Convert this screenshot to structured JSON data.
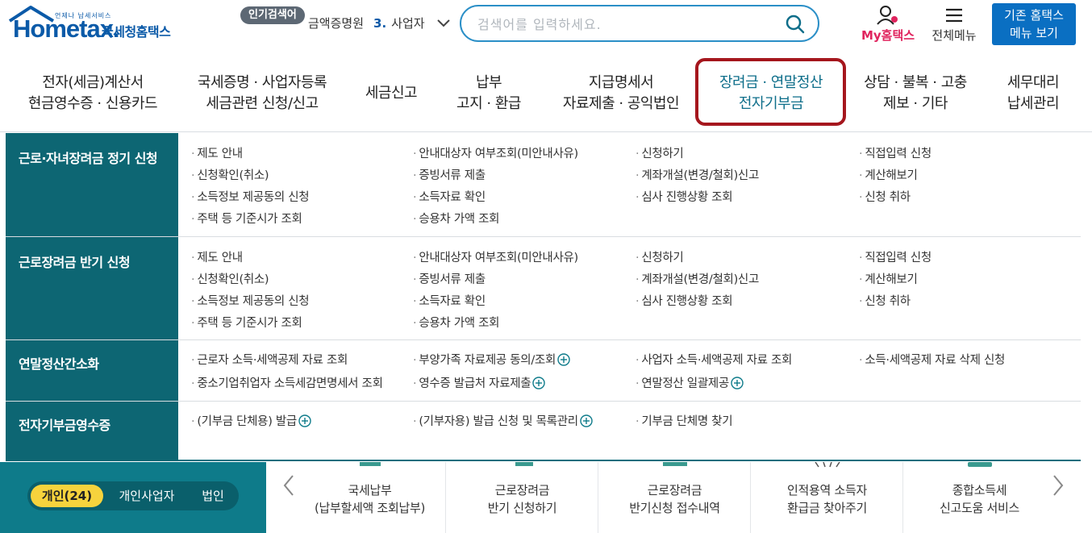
{
  "header": {
    "logo_small": "언제나 납세서비스",
    "logo_brand": "Hometax.",
    "logo_kr": "국세청홈택스",
    "popular_badge": "인기검색어",
    "ticker_text": "금액증명원",
    "ticker_num": "3.",
    "ticker_next": "사업자",
    "search_placeholder": "검색어를 입력하세요.",
    "my_hometax": "My홈택스",
    "all_menu": "전체메뉴",
    "old_menu_line1": "기존 홈택스",
    "old_menu_line2": "메뉴 보기"
  },
  "gnb": [
    {
      "line1": "전자(세금)계산서",
      "line2": "현금영수증 · 신용카드"
    },
    {
      "line1": "국세증명 · 사업자등록",
      "line2": "세금관련 신청/신고"
    },
    {
      "line1": "세금신고",
      "line2": ""
    },
    {
      "line1": "납부",
      "line2": "고지 · 환급"
    },
    {
      "line1": "지급명세서",
      "line2": "자료제출 · 공익법인"
    },
    {
      "line1": "장려금 · 연말정산",
      "line2": "전자기부금"
    },
    {
      "line1": "상담 · 불복 · 고충",
      "line2": "제보 · 기타"
    },
    {
      "line1": "세무대리",
      "line2": "납세관리"
    }
  ],
  "mega": {
    "rows": [
      {
        "title": "근로·자녀장려금 정기 신청",
        "links": [
          "제도 안내",
          "안내대상자 여부조회(미안내사유)",
          "신청하기",
          "직접입력 신청",
          "신청확인(취소)",
          "증빙서류 제출",
          "계좌개설(변경/철회)신고",
          "계산해보기",
          "소득정보 제공동의 신청",
          "소득자료 확인",
          "심사 진행상황 조회",
          "신청 취하",
          "주택 등 기준시가 조회",
          "승용차 가액 조회"
        ]
      },
      {
        "title": "근로장려금 반기 신청",
        "links": [
          "제도 안내",
          "안내대상자 여부조회(미안내사유)",
          "신청하기",
          "직접입력 신청",
          "신청확인(취소)",
          "증빙서류 제출",
          "계좌개설(변경/철회)신고",
          "계산해보기",
          "소득정보 제공동의 신청",
          "소득자료 확인",
          "심사 진행상황 조회",
          "신청 취하",
          "주택 등 기준시가 조회",
          "승용차 가액 조회"
        ]
      },
      {
        "title": "연말정산간소화",
        "links": [
          "근로자 소득·세액공제 자료 조회",
          "부양가족 자료제공 동의/조회",
          "사업자 소득·세액공제 자료 조회",
          "소득·세액공제 자료 삭제 신청",
          "중소기업취업자 소득세감면명세서 조회",
          "영수증 발급처 자료제출",
          "연말정산 일괄제공"
        ]
      },
      {
        "title": "전자기부금영수증",
        "links": [
          "(기부금 단체용) 발급",
          "(기부자용) 발급 신청 및 목록관리",
          "기부금 단체명 찾기"
        ]
      }
    ]
  },
  "bottom": {
    "tabs": [
      "개인(24)",
      "개인사업자",
      "법인"
    ],
    "services": [
      {
        "line1": "국세납부",
        "line2": "(납부할세액 조회납부)"
      },
      {
        "line1": "근로장려금",
        "line2": "반기 신청하기"
      },
      {
        "line1": "근로장려금",
        "line2": "반기신청 접수내역"
      },
      {
        "line1": "인적용역 소득자",
        "line2": "환급금 찾아주기"
      },
      {
        "line1": "종합소득세",
        "line2": "신고도움 서비스"
      }
    ]
  },
  "colors": {
    "brand_blue": "#0b5aa8",
    "teal": "#0d6673",
    "highlight_red": "#a5161d",
    "my_pink": "#e0245e",
    "tab_yellow": "#f6d33d"
  }
}
